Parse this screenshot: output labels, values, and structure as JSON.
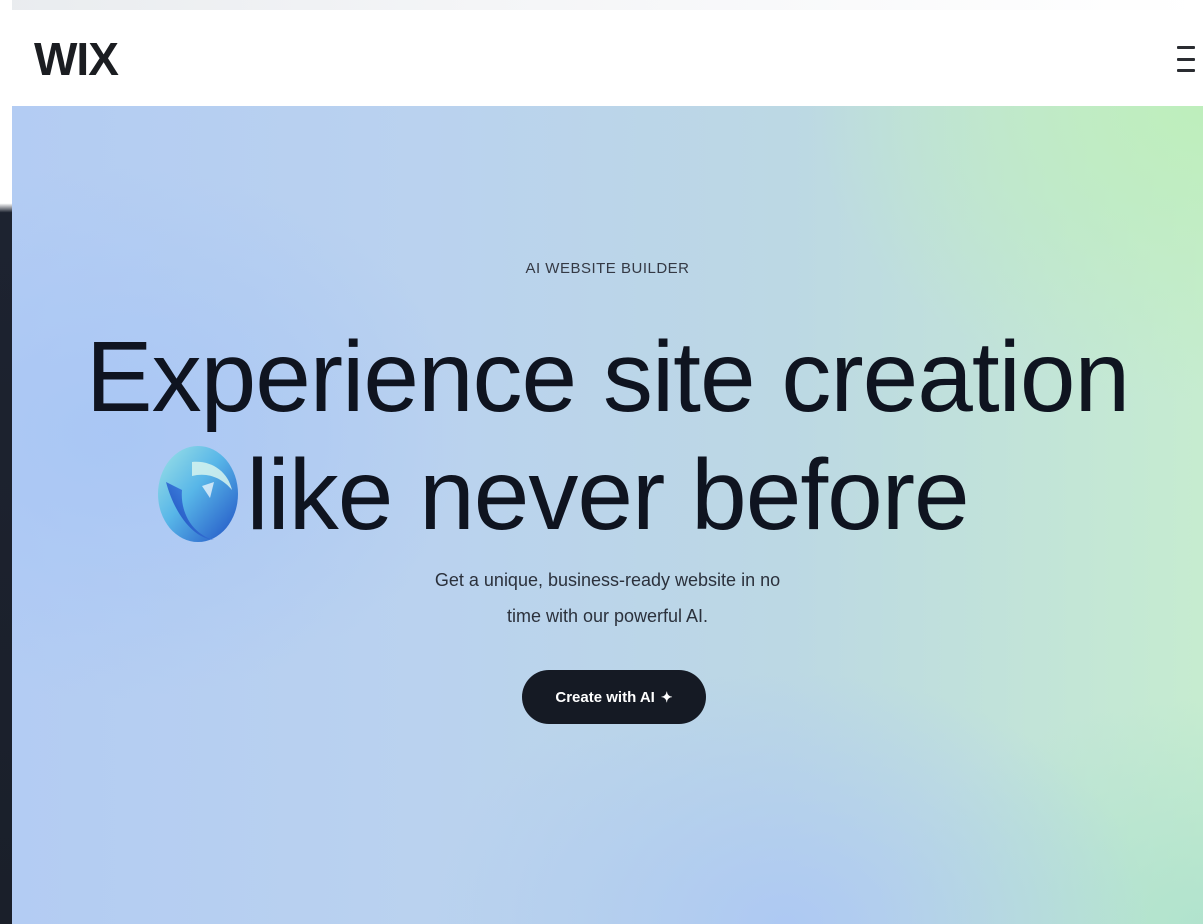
{
  "header": {
    "logo": "WIX",
    "menu_icon": "hamburger-menu-icon"
  },
  "hero": {
    "eyebrow": "AI WEBSITE BUILDER",
    "headline_line1": "Experience site creation",
    "headline_line2": "like never before",
    "subtitle_line1": "Get a unique, business-ready website in no",
    "subtitle_line2": "time with our powerful AI.",
    "cta_label": "Create with AI",
    "cta_icon": "sparkle-icon",
    "cta_icon_glyph": "✦",
    "decor_icon": "ai-orb-icon"
  },
  "colors": {
    "cta_background": "#151a24",
    "headline": "#0f1420",
    "gradient_blue": "#b3ccf3",
    "gradient_green": "#c6ecd0"
  }
}
